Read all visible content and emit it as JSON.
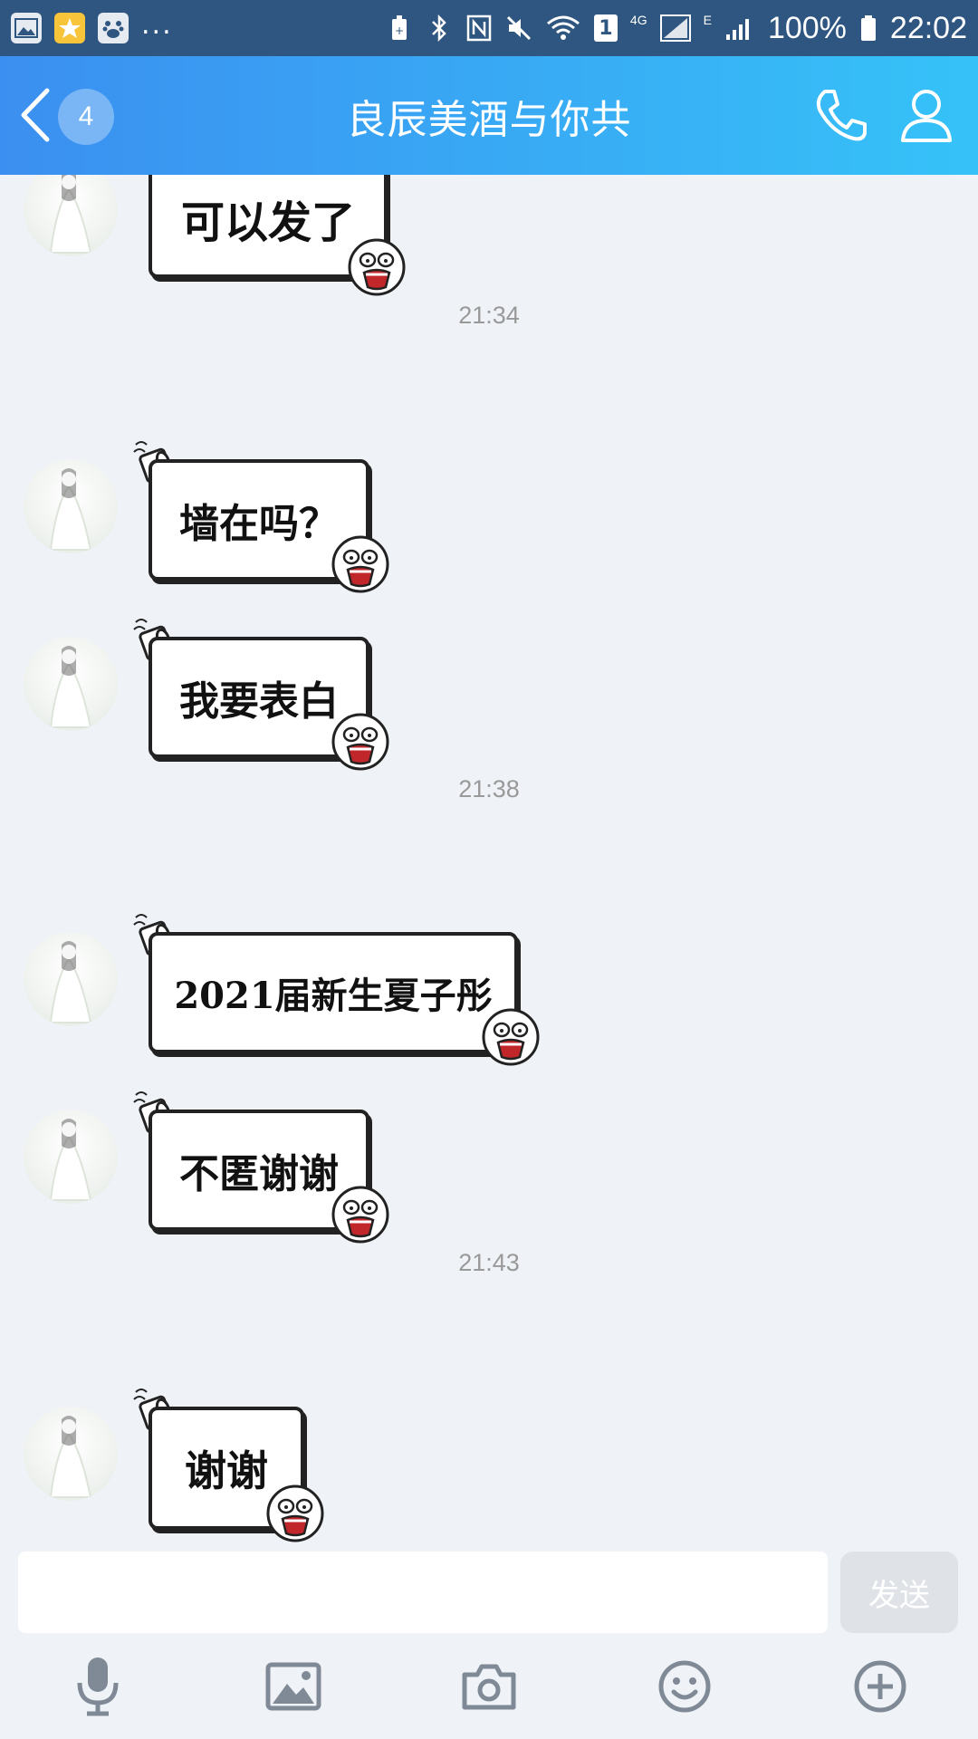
{
  "status_bar": {
    "battery": "100%",
    "time": "22:02",
    "ellipsis": "...",
    "sim_badge": "1",
    "network_4g": "4G",
    "network_e": "E",
    "icons": [
      "gallery-icon",
      "qzone-icon",
      "baidu-icon",
      "battery-saver-icon",
      "bluetooth-icon",
      "nfc-icon",
      "mute-icon",
      "wifi-icon",
      "signal-icon",
      "battery-icon"
    ]
  },
  "header": {
    "badge": "4",
    "title": "良辰美酒与你共"
  },
  "messages": [
    {
      "kind": "sticker",
      "text": "可以发了"
    },
    {
      "kind": "time",
      "text": "21:34"
    },
    {
      "kind": "sticker",
      "text": "墙在吗？"
    },
    {
      "kind": "sticker",
      "text": "我要表白"
    },
    {
      "kind": "time",
      "text": "21:38"
    },
    {
      "kind": "sticker",
      "text": "2021届新生夏子彤"
    },
    {
      "kind": "sticker",
      "text": "不匿谢谢"
    },
    {
      "kind": "time",
      "text": "21:43"
    },
    {
      "kind": "sticker",
      "text": "谢谢"
    }
  ],
  "input": {
    "value": "",
    "placeholder": "",
    "send_label": "发送"
  },
  "colors": {
    "header_start": "#3b8ff0",
    "header_end": "#36c2f8",
    "status_bar": "#2f5680",
    "background": "#eff2f6"
  }
}
